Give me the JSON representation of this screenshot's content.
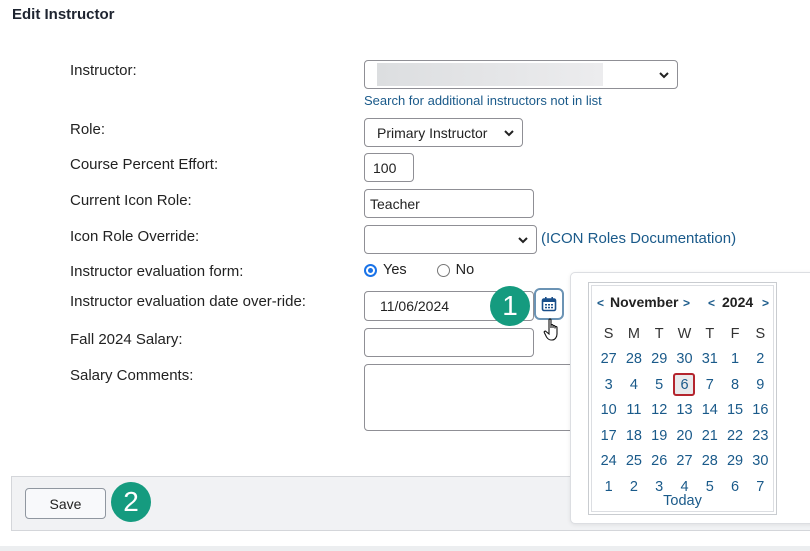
{
  "page_title": "Edit Instructor",
  "form": {
    "instructor": {
      "label": "Instructor:",
      "value": "",
      "search_link": "Search for additional instructors not in list"
    },
    "role": {
      "label": "Role:",
      "value": "Primary Instructor"
    },
    "percent_effort": {
      "label": "Course Percent Effort:",
      "value": "100"
    },
    "current_icon_role": {
      "label": "Current Icon Role:",
      "value": "Teacher"
    },
    "icon_role_override": {
      "label": "Icon Role Override:",
      "value": "",
      "paren_open": "(",
      "doc_link": "ICON Roles Documentation",
      "paren_close": ")"
    },
    "eval_form": {
      "label": "Instructor evaluation form:",
      "options": [
        "Yes",
        "No"
      ],
      "selected": "Yes"
    },
    "eval_date": {
      "label": "Instructor evaluation date over-ride:",
      "value": "11/06/2024"
    },
    "salary": {
      "label": "Fall 2024 Salary:",
      "value": ""
    },
    "salary_comments": {
      "label": "Salary Comments:",
      "value": ""
    }
  },
  "badges": {
    "one": "1",
    "two": "2"
  },
  "footer": {
    "save_label": "Save"
  },
  "calendar": {
    "month": "November",
    "year": "2024",
    "prev": "<",
    "next": ">",
    "weekdays": [
      "S",
      "M",
      "T",
      "W",
      "T",
      "F",
      "S"
    ],
    "weeks": [
      [
        "27",
        "28",
        "29",
        "30",
        "31",
        "1",
        "2"
      ],
      [
        "3",
        "4",
        "5",
        "6",
        "7",
        "8",
        "9"
      ],
      [
        "10",
        "11",
        "12",
        "13",
        "14",
        "15",
        "16"
      ],
      [
        "17",
        "18",
        "19",
        "20",
        "21",
        "22",
        "23"
      ],
      [
        "24",
        "25",
        "26",
        "27",
        "28",
        "29",
        "30"
      ],
      [
        "1",
        "2",
        "3",
        "4",
        "5",
        "6",
        "7"
      ]
    ],
    "selected_day": "6",
    "today_label": "Today"
  }
}
